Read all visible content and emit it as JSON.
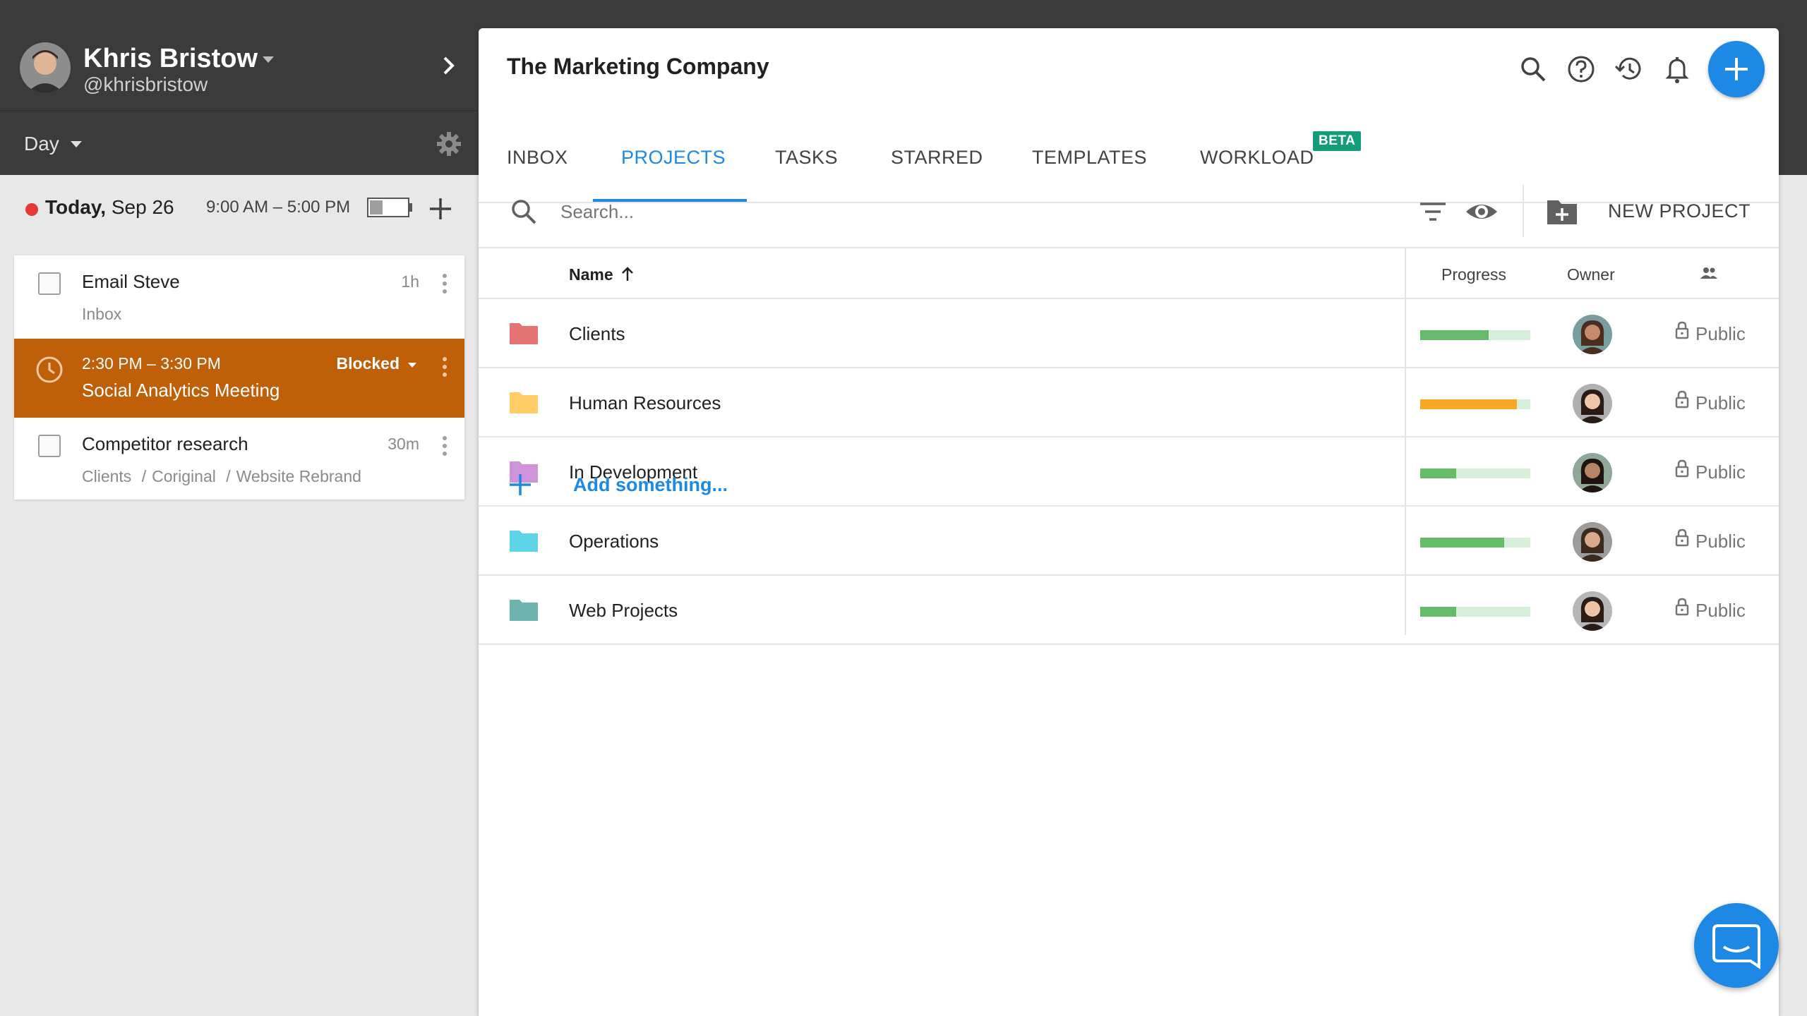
{
  "sidebar": {
    "user": {
      "name": "Khris Bristow",
      "handle": "@khrisbristow"
    },
    "view_selector": "Day",
    "today": {
      "label_bold": "Today,",
      "label_date": "Sep 26",
      "hours": "9:00 AM – 5:00 PM",
      "battery_fraction": 0.33
    },
    "tasks": [
      {
        "title": "Email Steve",
        "sub": "Inbox",
        "duration": "1h"
      },
      {
        "time": "2:30 PM – 3:30 PM",
        "title": "Social Analytics Meeting",
        "status": "Blocked",
        "color": "#bf5f08"
      },
      {
        "title": "Competitor research",
        "duration": "30m",
        "path": [
          "Clients",
          "Coriginal",
          "Website Rebrand"
        ],
        "path_sep": "/"
      }
    ]
  },
  "main": {
    "company": "The Marketing Company",
    "top_icons": [
      "search-icon",
      "help-icon",
      "history-icon",
      "bell-icon",
      "add-icon"
    ],
    "tabs": [
      {
        "label": "INBOX"
      },
      {
        "label": "PROJECTS",
        "active": true
      },
      {
        "label": "TASKS"
      },
      {
        "label": "STARRED"
      },
      {
        "label": "TEMPLATES"
      },
      {
        "label": "WORKLOAD",
        "badge": "BETA"
      }
    ],
    "search": {
      "placeholder": "Search..."
    },
    "new_project_label": "NEW PROJECT",
    "table": {
      "columns": {
        "name": "Name",
        "progress": "Progress",
        "owner": "Owner"
      },
      "rows": [
        {
          "name": "Clients",
          "folder_color": "#e57373",
          "progress": 0.62,
          "bar_color": "#66bb6a",
          "visibility": "Public"
        },
        {
          "name": "Human Resources",
          "folder_color": "#ffcc66",
          "progress": 0.88,
          "bar_color": "#f9a825",
          "visibility": "Public"
        },
        {
          "name": "In Development",
          "folder_color": "#ce93d8",
          "progress": 0.33,
          "bar_color": "#66bb6a",
          "visibility": "Public"
        },
        {
          "name": "Operations",
          "folder_color": "#5ed3e6",
          "progress": 0.76,
          "bar_color": "#66bb6a",
          "visibility": "Public"
        },
        {
          "name": "Web Projects",
          "folder_color": "#6fb3ae",
          "progress": 0.33,
          "bar_color": "#66bb6a",
          "visibility": "Public"
        }
      ]
    },
    "add_label": "Add something...",
    "accent": "#1e88e5"
  }
}
